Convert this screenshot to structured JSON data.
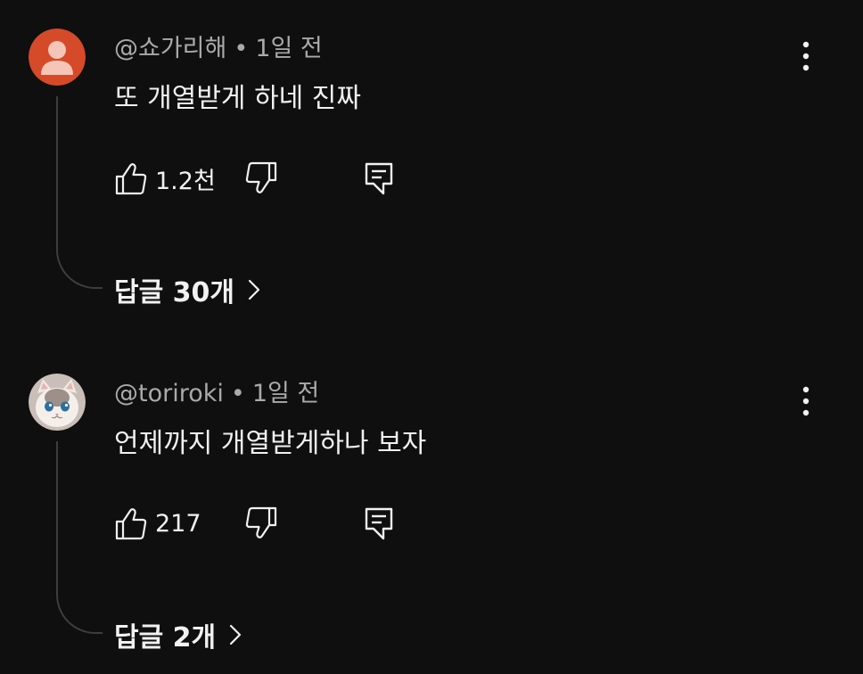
{
  "comments": [
    {
      "author": "@쇼가리해",
      "time": "1일 전",
      "text": "또 개열받게 하네 진짜",
      "likes": "1.2천",
      "replies_label": "답글 30개",
      "avatar": "default-person-avatar",
      "avatar_color": "#d54b2a"
    },
    {
      "author": "@toriroki",
      "time": "1일 전",
      "text": "언제까지 개열받게하나 보자",
      "likes": "217",
      "replies_label": "답글 2개",
      "avatar": "cat-avatar",
      "avatar_color": "#c9bfb8"
    }
  ],
  "separator": "•",
  "colors": {
    "background": "#0f0f0f",
    "primary_text": "#f1f1f1",
    "secondary_text": "#aaaaaa",
    "thread_line": "#3d3d3d"
  },
  "icons": {
    "like": "thumbs-up-icon",
    "dislike": "thumbs-down-icon",
    "reply": "comment-icon",
    "more": "more-vertical-icon",
    "expand": "chevron-right-icon"
  }
}
